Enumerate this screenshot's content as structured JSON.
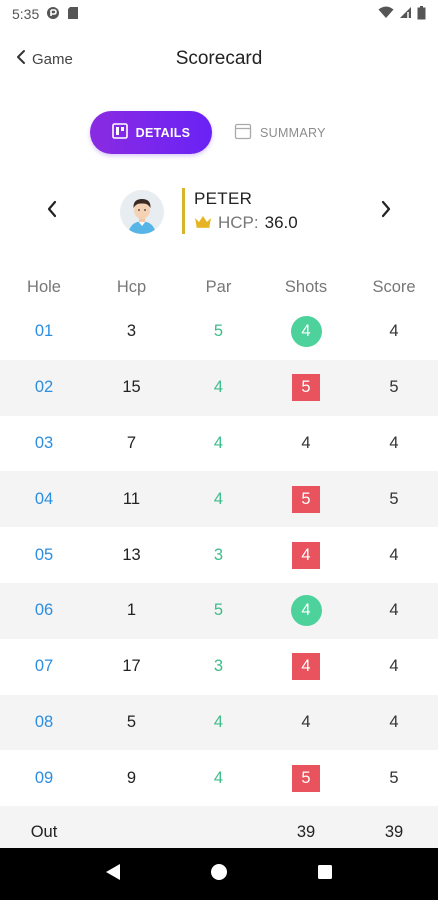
{
  "status_bar": {
    "time": "5:35"
  },
  "app_bar": {
    "back_label": "Game",
    "title": "Scorecard"
  },
  "tabs": {
    "details": "DETAILS",
    "summary": "SUMMARY"
  },
  "player": {
    "name": "PETER",
    "hcp_label": "HCP:",
    "hcp_value": "36.0"
  },
  "table": {
    "headers": [
      "Hole",
      "Hcp",
      "Par",
      "Shots",
      "Score"
    ],
    "rows": [
      {
        "hole": "01",
        "hcp": "3",
        "par": "5",
        "shots": "4",
        "shots_style": "under",
        "score": "4"
      },
      {
        "hole": "02",
        "hcp": "15",
        "par": "4",
        "shots": "5",
        "shots_style": "over",
        "score": "5"
      },
      {
        "hole": "03",
        "hcp": "7",
        "par": "4",
        "shots": "4",
        "shots_style": "par",
        "score": "4"
      },
      {
        "hole": "04",
        "hcp": "11",
        "par": "4",
        "shots": "5",
        "shots_style": "over",
        "score": "5"
      },
      {
        "hole": "05",
        "hcp": "13",
        "par": "3",
        "shots": "4",
        "shots_style": "over",
        "score": "4"
      },
      {
        "hole": "06",
        "hcp": "1",
        "par": "5",
        "shots": "4",
        "shots_style": "under",
        "score": "4"
      },
      {
        "hole": "07",
        "hcp": "17",
        "par": "3",
        "shots": "4",
        "shots_style": "over",
        "score": "4"
      },
      {
        "hole": "08",
        "hcp": "5",
        "par": "4",
        "shots": "4",
        "shots_style": "par",
        "score": "4"
      },
      {
        "hole": "09",
        "hcp": "9",
        "par": "4",
        "shots": "5",
        "shots_style": "over",
        "score": "5"
      }
    ],
    "out": {
      "label": "Out",
      "shots": "39",
      "score": "39"
    }
  },
  "colors": {
    "accent": "#7b2ff0",
    "hole_link": "#2b8ee0",
    "par": "#3cbd8a",
    "under_par": "#4cd29a",
    "over_par": "#e9535d",
    "hcp_bar": "#d7b52a"
  },
  "icons": {
    "back": "chevron-left-icon",
    "details": "board-icon",
    "summary": "calendar-icon",
    "prev": "chevron-left-icon",
    "next": "chevron-right-icon",
    "crown": "crown-icon",
    "nav_back": "triangle-back-icon",
    "nav_home": "circle-home-icon",
    "nav_recents": "square-recents-icon"
  }
}
